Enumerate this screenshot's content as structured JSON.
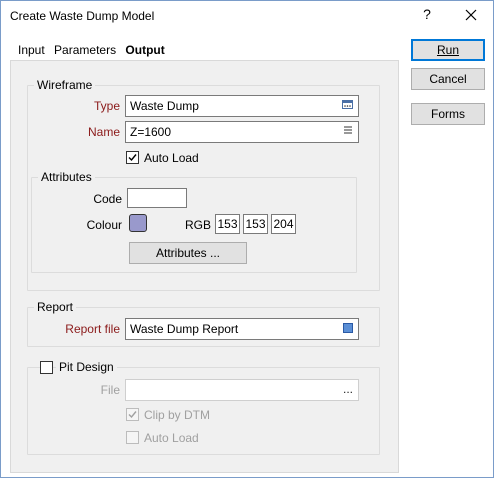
{
  "window": {
    "title": "Create Waste Dump Model",
    "help_glyph": "?",
    "close_glyph": "✕"
  },
  "tabs": [
    {
      "label": "Input",
      "active": false
    },
    {
      "label": "Parameters",
      "active": false
    },
    {
      "label": "Output",
      "active": true
    }
  ],
  "buttons": {
    "run": "Run",
    "cancel": "Cancel",
    "forms": "Forms"
  },
  "wireframe": {
    "title": "Wireframe",
    "type_label": "Type",
    "type_value": "Waste Dump",
    "name_label": "Name",
    "name_value": "Z=1600",
    "auto_load_label": "Auto Load",
    "auto_load_checked": true,
    "attributes": {
      "title": "Attributes",
      "code_label": "Code",
      "code_value": "",
      "colour_label": "Colour",
      "colour_hex": "#9999cc",
      "rgb_label": "RGB",
      "r": "153",
      "g": "153",
      "b": "204",
      "attributes_button": "Attributes ..."
    }
  },
  "report": {
    "title": "Report",
    "file_label": "Report file",
    "file_value": "Waste Dump Report"
  },
  "pit_design": {
    "title": "Pit Design",
    "enabled": false,
    "file_label": "File",
    "file_value": "",
    "file_button": "...",
    "clip_by_dtm_label": "Clip by DTM",
    "clip_by_dtm_checked": true,
    "auto_load_label": "Auto Load",
    "auto_load_checked": false
  },
  "icons": {
    "type_browse": "browse-icon",
    "name_list": "list-icon",
    "report_browse": "report-file-icon"
  }
}
